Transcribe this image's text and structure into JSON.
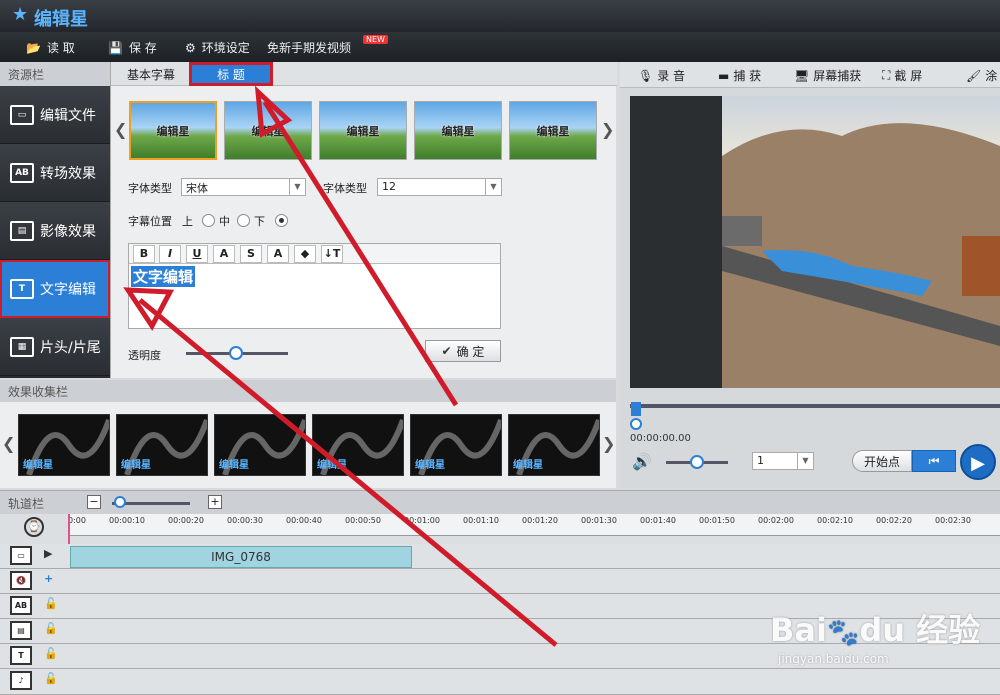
{
  "app": {
    "title": "编辑星"
  },
  "menu": {
    "items": [
      "读 取",
      "保 存",
      "环境设定",
      "免新手期发视频"
    ],
    "badge": "NEW"
  },
  "sidebar": {
    "header": "资源栏",
    "items": [
      "编辑文件",
      "转场效果",
      "影像效果",
      "文字编辑",
      "片头/片尾"
    ],
    "active": 3
  },
  "editor": {
    "tabs": [
      "基本字幕",
      "标 题"
    ],
    "selected_tab": 1,
    "thumbnails": [
      "编辑星",
      "编辑星",
      "编辑星",
      "编辑星",
      "编辑星"
    ],
    "font_type_label": "字体类型",
    "font_type_value": "宋体",
    "font_size_label": "字体类型",
    "font_size_value": "12",
    "position_label": "字幕位置",
    "pos_top": "上",
    "pos_mid": "中",
    "pos_bottom": "下",
    "toolbar": [
      "B",
      "I",
      "U",
      "A",
      "S",
      "A",
      "◆",
      "↓T"
    ],
    "text": "文字编辑",
    "opacity_label": "透明度",
    "confirm_label": "确 定"
  },
  "fx": {
    "header": "效果收集栏",
    "items": [
      "编辑星",
      "编辑星",
      "编辑星",
      "编辑星",
      "编辑星",
      "编辑星"
    ]
  },
  "right_tools": [
    "录 音",
    "捕 获",
    "屏幕捕获",
    "截 屏",
    "涂"
  ],
  "preview": {
    "timecode": "00:00:00.00",
    "speed": "1",
    "start_label": "开始点"
  },
  "timeline": {
    "header": "轨道栏",
    "ticks": [
      "0:00",
      "00:00:10",
      "00:00:20",
      "00:00:30",
      "00:00:40",
      "00:00:50",
      "00:01:00",
      "00:01:10",
      "00:01:20",
      "00:01:30",
      "00:01:40",
      "00:01:50",
      "00:02:00",
      "00:02:10",
      "00:02:20",
      "00:02:30"
    ],
    "clip": "IMG_0768",
    "tracks": [
      "video",
      "audio",
      "transition",
      "effect",
      "text",
      "music"
    ]
  },
  "colors": {
    "accent": "#2c7fd6",
    "highlight": "#d01c2a"
  }
}
